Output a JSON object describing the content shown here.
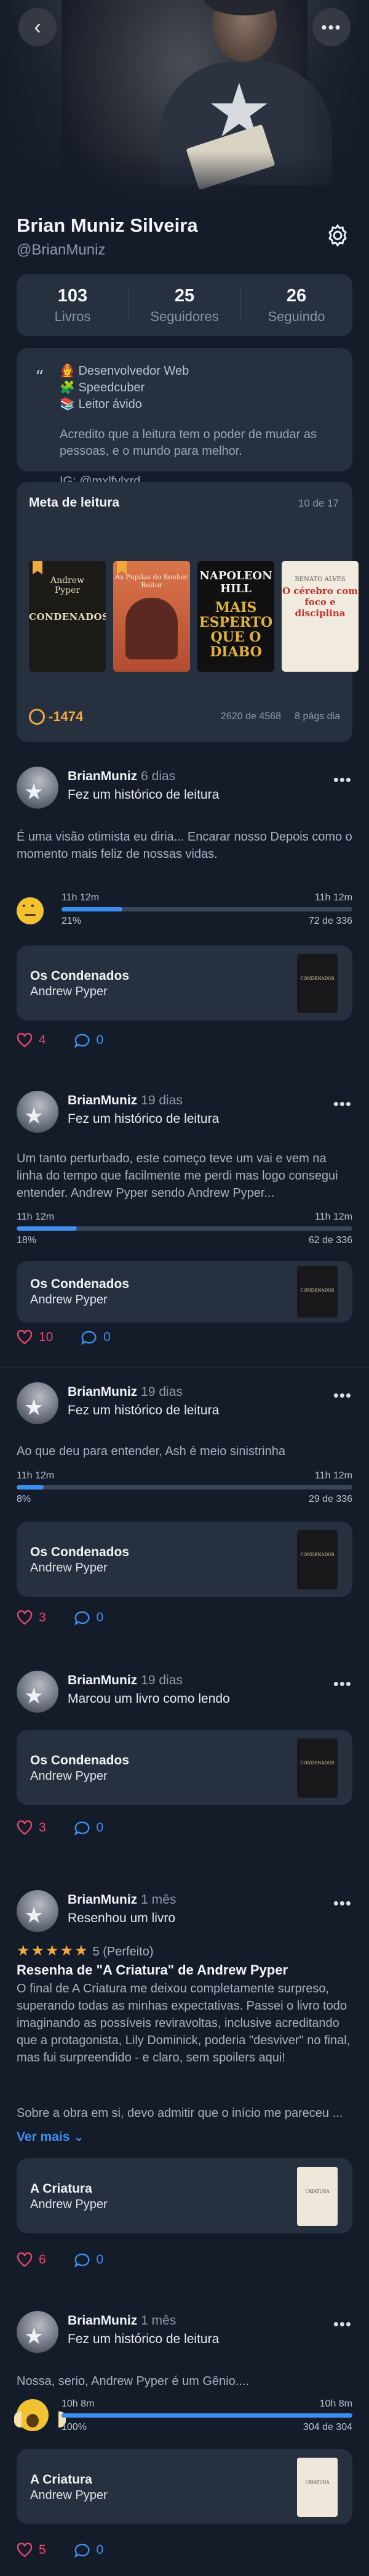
{
  "header": {
    "back_icon": "chevron-left-icon",
    "more_icon": "ellipsis-icon"
  },
  "profile": {
    "name": "Brian Muniz Silveira",
    "handle": "@BrianMuniz",
    "settings_icon": "gear-icon"
  },
  "stats": [
    {
      "value": "103",
      "label": "Livros"
    },
    {
      "value": "25",
      "label": "Seguidores"
    },
    {
      "value": "26",
      "label": "Seguindo"
    }
  ],
  "bio": {
    "line1": "🧑‍🚒 Desenvolvedor Web",
    "line2": "🧩 Speedcuber",
    "line3": "📚 Leitor ávido",
    "quote": "Acredito que a leitura tem o poder de mudar as pessoas, e o mundo para melhor.",
    "ig": "IG: @mxlfylxrd"
  },
  "reading_goal": {
    "title": "Meta de leitura",
    "count": "10 de 17",
    "pages_delta": "-1474",
    "progress": "2620 de 4568",
    "per_day": "8 págs dia",
    "covers": [
      {
        "line1": "Andrew",
        "line2": "Pyper",
        "title": "CONDENADOS"
      },
      {
        "title": "As Pupilas do Senhor Reitor"
      },
      {
        "author": "NAPOLEON HILL",
        "title": "MAIS ESPERTO QUE O DIABO"
      },
      {
        "author": "RENATO ALVES",
        "title": "O cérebro com foco e disciplina"
      }
    ]
  },
  "posts": [
    {
      "user": "BrianMuniz",
      "when": "6 dias",
      "action": "Fez um histórico de leitura",
      "text": "É uma visão otimista eu diria... Encarar nosso Depois como o momento mais feliz de nossas vidas.",
      "time_left": "11h 12m",
      "time_right": "11h 12m",
      "percent": "21%",
      "pages": "72 de 336",
      "progress_fraction": 0.21,
      "book_title": "Os Condenados",
      "book_author": "Andrew Pyper",
      "likes": "4",
      "comments": "0"
    },
    {
      "user": "BrianMuniz",
      "when": "19 dias",
      "action": "Fez um histórico de leitura",
      "text": "Um tanto perturbado, este começo teve um vai e vem na linha do tempo que facilmente me perdi mas logo consegui entender. Andrew Pyper sendo Andrew Pyper...",
      "time_left": "11h 12m",
      "time_right": "11h 12m",
      "percent": "18%",
      "pages": "62 de 336",
      "progress_fraction": 0.18,
      "book_title": "Os Condenados",
      "book_author": "Andrew Pyper",
      "likes": "10",
      "comments": "0"
    },
    {
      "user": "BrianMuniz",
      "when": "19 dias",
      "action": "Fez um histórico de leitura",
      "text": "Ao que deu para entender, Ash é meio sinistrinha",
      "time_left": "11h 12m",
      "time_right": "11h 12m",
      "percent": "8%",
      "pages": "29 de 336",
      "progress_fraction": 0.08,
      "book_title": "Os Condenados",
      "book_author": "Andrew Pyper",
      "likes": "3",
      "comments": "0"
    },
    {
      "user": "BrianMuniz",
      "when": "19 dias",
      "action": "Marcou um livro como lendo",
      "book_title": "Os Condenados",
      "book_author": "Andrew Pyper",
      "likes": "3",
      "comments": "0"
    },
    {
      "user": "BrianMuniz",
      "when": "1 mês",
      "action": "Resenhou um livro",
      "rating_label": "5 (Perfeito)",
      "review_title": "Resenha de \"A Criatura\" de Andrew Pyper",
      "text": "O final de A Criatura me deixou completamente surpreso, superando todas as minhas expectativas. Passei o livro todo imaginando as possíveis reviravoltas, inclusive acreditando que a protagonista, Lily Dominick, poderia \"desviver\" no final, mas fui surpreendido - e claro, sem spoilers aqui!",
      "text2": "Sobre a obra em si, devo admitir que o início me pareceu ...",
      "see_more": "Ver mais",
      "book_title": "A Criatura",
      "book_author": "Andrew Pyper",
      "likes": "6",
      "comments": "0"
    },
    {
      "user": "BrianMuniz",
      "when": "1 mês",
      "action": "Fez um histórico de leitura",
      "text": "Nossa, serio, Andrew Pyper é um Gênio....",
      "time_left": "10h 8m",
      "time_right": "10h 8m",
      "percent": "100%",
      "pages": "304 de 304",
      "progress_fraction": 1.0,
      "book_title": "A Criatura",
      "book_author": "Andrew Pyper",
      "likes": "5",
      "comments": "0"
    }
  ],
  "colors": {
    "background": "#141c29",
    "card": "#26303f",
    "accent": "#3c8ff0",
    "like": "#e8476e",
    "goal": "#f0a93b"
  }
}
